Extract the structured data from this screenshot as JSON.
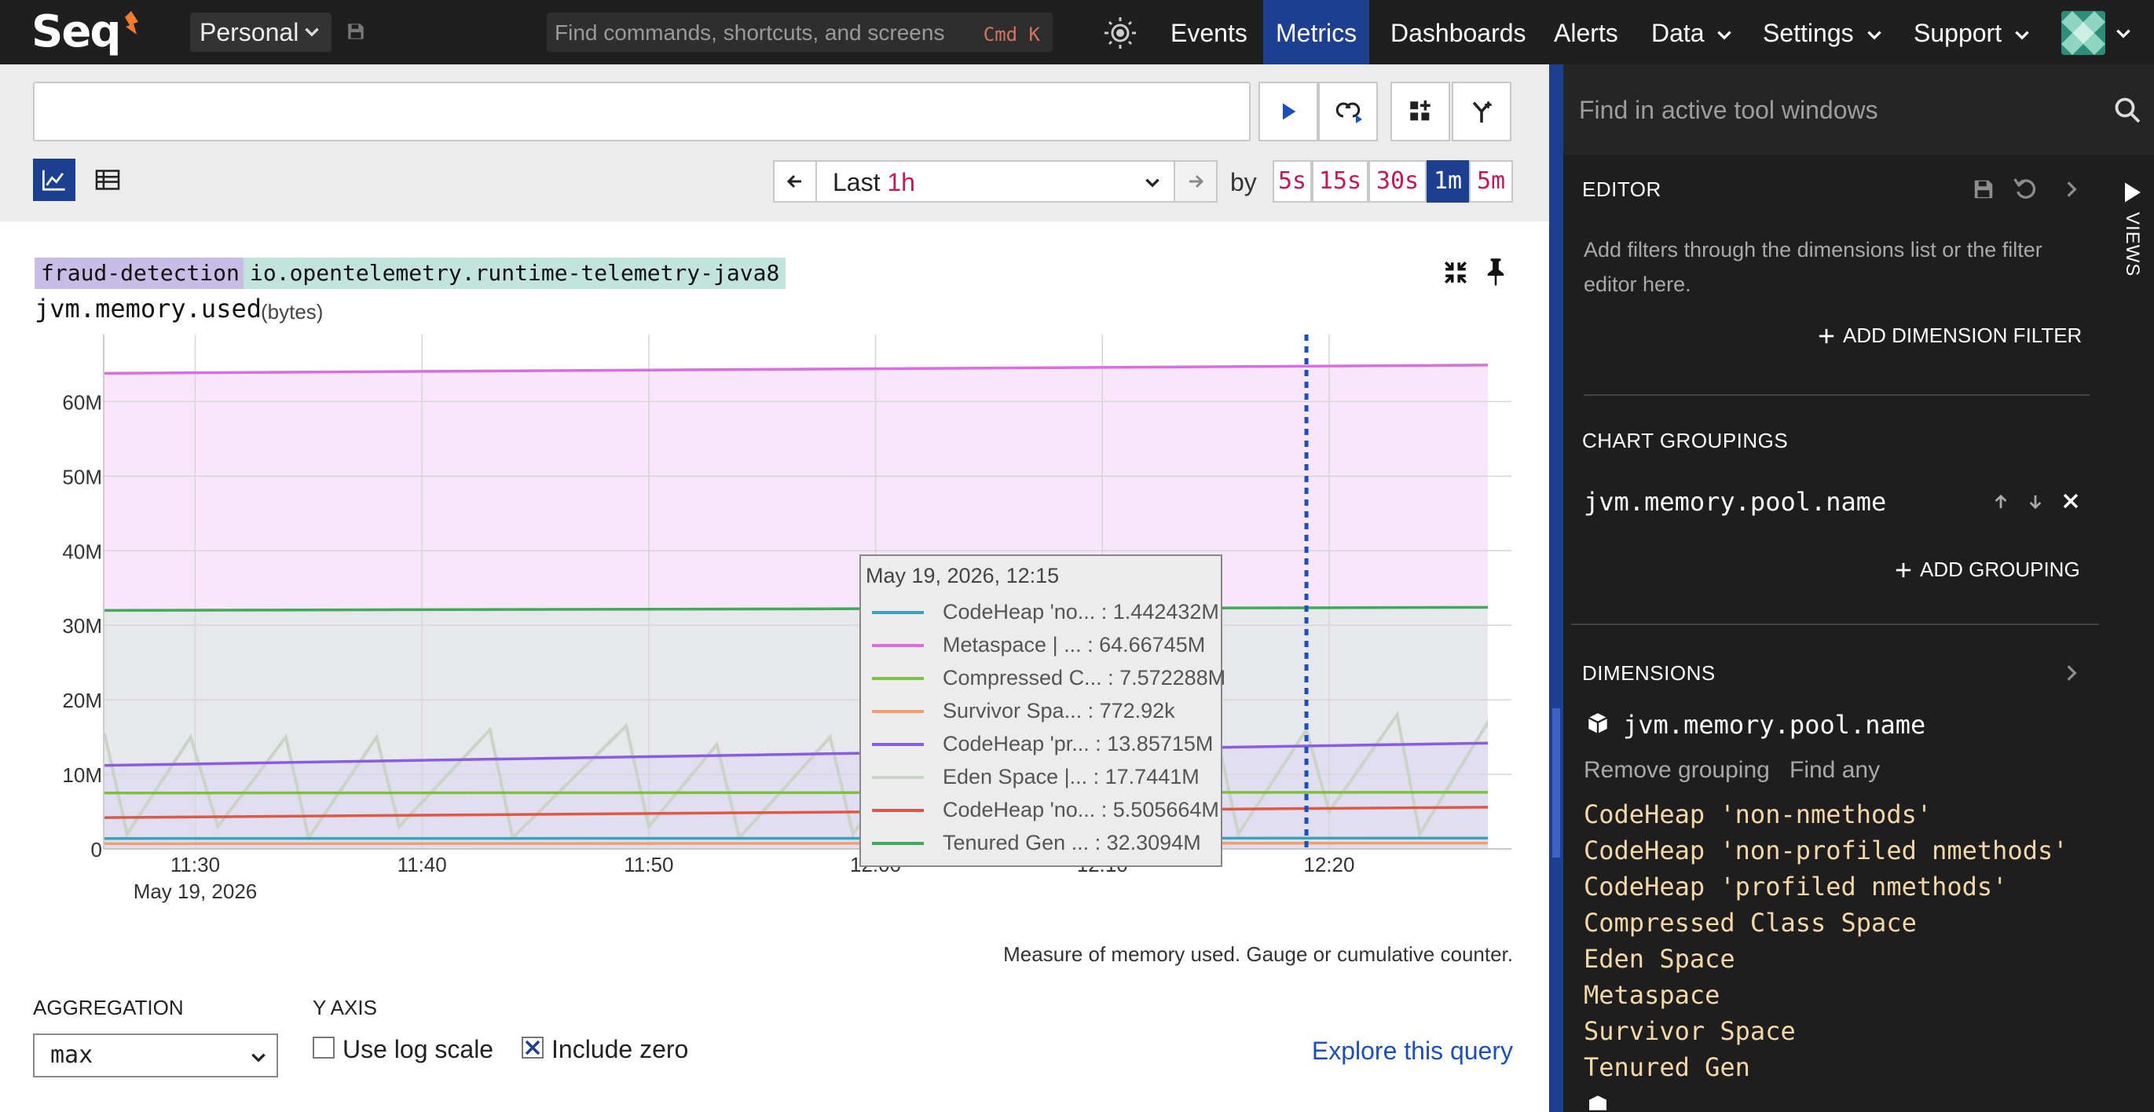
{
  "app": {
    "logo": "Seq"
  },
  "nav": {
    "workspace": "Personal",
    "command_search_placeholder": "Find commands, shortcuts, and screens",
    "command_search_shortcut": "Cmd  K",
    "links": [
      {
        "label": "Events"
      },
      {
        "label": "Metrics",
        "active": true
      },
      {
        "label": "Dashboards"
      },
      {
        "label": "Alerts"
      },
      {
        "label": "Data"
      },
      {
        "label": "Settings"
      },
      {
        "label": "Support"
      }
    ]
  },
  "query": {
    "value": "",
    "range_prefix": "Last",
    "range_value": "1h",
    "by_label": "by",
    "intervals": [
      "5s",
      "15s",
      "30s",
      "1m",
      "5m"
    ],
    "active_interval": "1m"
  },
  "chart": {
    "tags": [
      "fraud-detection",
      "io.opentelemetry.runtime-telemetry-java8"
    ],
    "metric": "jvm.memory.used",
    "unit": "(bytes)",
    "description": "Measure of memory used. Gauge or cumulative counter.",
    "tooltip_date": "May 19, 2026, 12:15",
    "tooltip_rows": [
      {
        "text": "CodeHeap 'no... : 1.442432M",
        "color": "#3aa3b9"
      },
      {
        "text": "Metaspace | ... : 64.66745M",
        "color": "#d86ee0"
      },
      {
        "text": "Compressed C... : 7.572288M",
        "color": "#7fbf3f"
      },
      {
        "text": "Survivor Spa... : 772.92k",
        "color": "#f0a070"
      },
      {
        "text": "CodeHeap 'pr... : 13.85715M",
        "color": "#8a5ce0"
      },
      {
        "text": "Eden Space |... : 17.7441M",
        "color": "#c9d4c6"
      },
      {
        "text": "CodeHeap 'no... : 5.505664M",
        "color": "#dc5a45"
      },
      {
        "text": "Tenured Gen ... : 32.3094M",
        "color": "#43a85a"
      }
    ]
  },
  "chart_data": {
    "type": "line",
    "x_tick_labels": [
      "11:30",
      "11:40",
      "11:50",
      "12:00",
      "12:10",
      "12:20"
    ],
    "x_subtitle": "May 19, 2026",
    "y_tick_labels": [
      "0",
      "10M",
      "20M",
      "30M",
      "40M",
      "50M",
      "60M"
    ],
    "ylim": [
      0,
      69000000
    ],
    "x_range_minutes": [
      -4,
      57
    ],
    "cursor_minute": 49,
    "grid": true,
    "series": [
      {
        "name": "Metaspace",
        "color": "#d86ee0",
        "fill": "#f9e6fb",
        "values": [
          [
            -4,
            63800000
          ],
          [
            57,
            64900000
          ]
        ]
      },
      {
        "name": "Tenured Gen",
        "color": "#43a85a",
        "fill": "#e6e8ec",
        "values": [
          [
            -4,
            32000000
          ],
          [
            57,
            32400000
          ]
        ]
      },
      {
        "name": "CodeHeap 'profiled nmethods'",
        "color": "#8a5ce0",
        "fill": "#e2def2",
        "values": [
          [
            -4,
            11200000
          ],
          [
            57,
            14200000
          ]
        ]
      },
      {
        "name": "Compressed Class Space",
        "color": "#7fbf3f",
        "values": [
          [
            -4,
            7500000
          ],
          [
            57,
            7600000
          ]
        ]
      },
      {
        "name": "CodeHeap 'non-profiled nmethods'",
        "color": "#dc5a45",
        "values": [
          [
            -4,
            4200000
          ],
          [
            57,
            5600000
          ]
        ]
      },
      {
        "name": "CodeHeap 'non-nmethods'",
        "color": "#3aa3b9",
        "values": [
          [
            -4,
            1400000
          ],
          [
            57,
            1450000
          ]
        ]
      },
      {
        "name": "Survivor Space",
        "color": "#f0a070",
        "values": [
          [
            -4,
            700000
          ],
          [
            57,
            780000
          ]
        ]
      },
      {
        "name": "Eden Space",
        "color": "#c9d4c6",
        "values": [
          [
            -4,
            15500000
          ],
          [
            -3,
            2000000
          ],
          [
            -0.2,
            15000000
          ],
          [
            1,
            3000000
          ],
          [
            4,
            15000000
          ],
          [
            5,
            1500000
          ],
          [
            8,
            15000000
          ],
          [
            9,
            3000000
          ],
          [
            13,
            16000000
          ],
          [
            14,
            1500000
          ],
          [
            19,
            16500000
          ],
          [
            20,
            3000000
          ],
          [
            23,
            14000000
          ],
          [
            24,
            1500000
          ],
          [
            28,
            15000000
          ],
          [
            29,
            2000000
          ],
          [
            32,
            15000000
          ],
          [
            33,
            1500000
          ],
          [
            37,
            15000000
          ],
          [
            38,
            2000000
          ],
          [
            41,
            15500000
          ],
          [
            42,
            1500000
          ],
          [
            45,
            16000000
          ],
          [
            46,
            2000000
          ],
          [
            49,
            16000000
          ],
          [
            50,
            5000000
          ],
          [
            53,
            18000000
          ],
          [
            54,
            2000000
          ],
          [
            57,
            17000000
          ],
          [
            58,
            4000000
          ],
          [
            61,
            18000000
          ],
          [
            62,
            3000000
          ],
          [
            65,
            10000000
          ]
        ]
      }
    ]
  },
  "controls": {
    "aggregation_label": "AGGREGATION",
    "aggregation_value": "max",
    "yaxis_label": "Y AXIS",
    "log_scale_label": "Use log scale",
    "log_scale_checked": false,
    "include_zero_label": "Include zero",
    "include_zero_checked": true,
    "explore_link": "Explore this query"
  },
  "panel": {
    "search_placeholder": "Find in active tool windows",
    "views_label": "VIEWS",
    "editor": {
      "title": "EDITOR",
      "hint": "Add filters through the dimensions list or the filter editor here.",
      "add_filter": "ADD DIMENSION FILTER"
    },
    "groupings": {
      "title": "CHART GROUPINGS",
      "item": "jvm.memory.pool.name",
      "add_grouping": "ADD GROUPING"
    },
    "dimensions": {
      "title": "DIMENSIONS",
      "name": "jvm.memory.pool.name",
      "remove_grouping": "Remove grouping",
      "find_any": "Find any",
      "values": [
        "CodeHeap 'non-nmethods'",
        "CodeHeap 'non-profiled nmethods'",
        "CodeHeap 'profiled nmethods'",
        "Compressed Class Space",
        "Eden Space",
        "Metaspace",
        "Survivor Space",
        "Tenured Gen"
      ]
    }
  }
}
